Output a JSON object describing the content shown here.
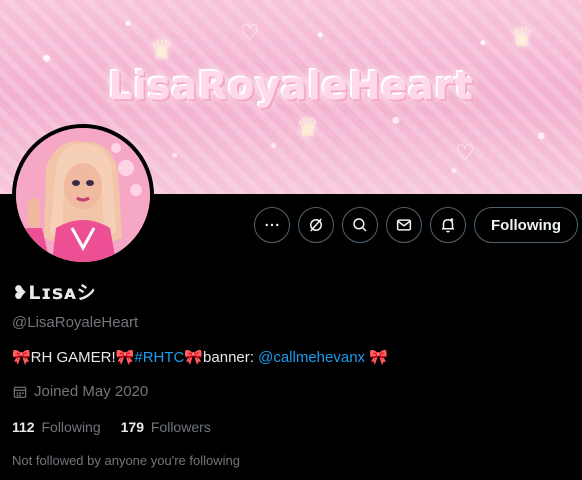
{
  "banner": {
    "title": "LisaRoyaleHeart"
  },
  "profile": {
    "display_name": "❥Lɪsᴀシ",
    "handle": "@LisaRoyaleHeart",
    "bio": {
      "part1": "🎀RH GAMER!🎀",
      "hashtag": "#RHTC",
      "part2": "🎀banner: ",
      "mention": "@callmehevanx",
      "part3": " 🎀"
    },
    "joined": "Joined May 2020",
    "following_count": "112",
    "following_label": "Following",
    "followers_count": "179",
    "followers_label": "Followers",
    "followed_by_note": "Not followed by anyone you're following"
  },
  "actions": {
    "follow_button_label": "Following",
    "icons": [
      "more-icon",
      "grok-icon",
      "search-icon",
      "message-icon",
      "notification-bell-icon"
    ]
  },
  "colors": {
    "background": "#000000",
    "accent_link": "#1d9bf0",
    "muted_text": "#71767b",
    "banner_pink": "#f4b3d0"
  }
}
